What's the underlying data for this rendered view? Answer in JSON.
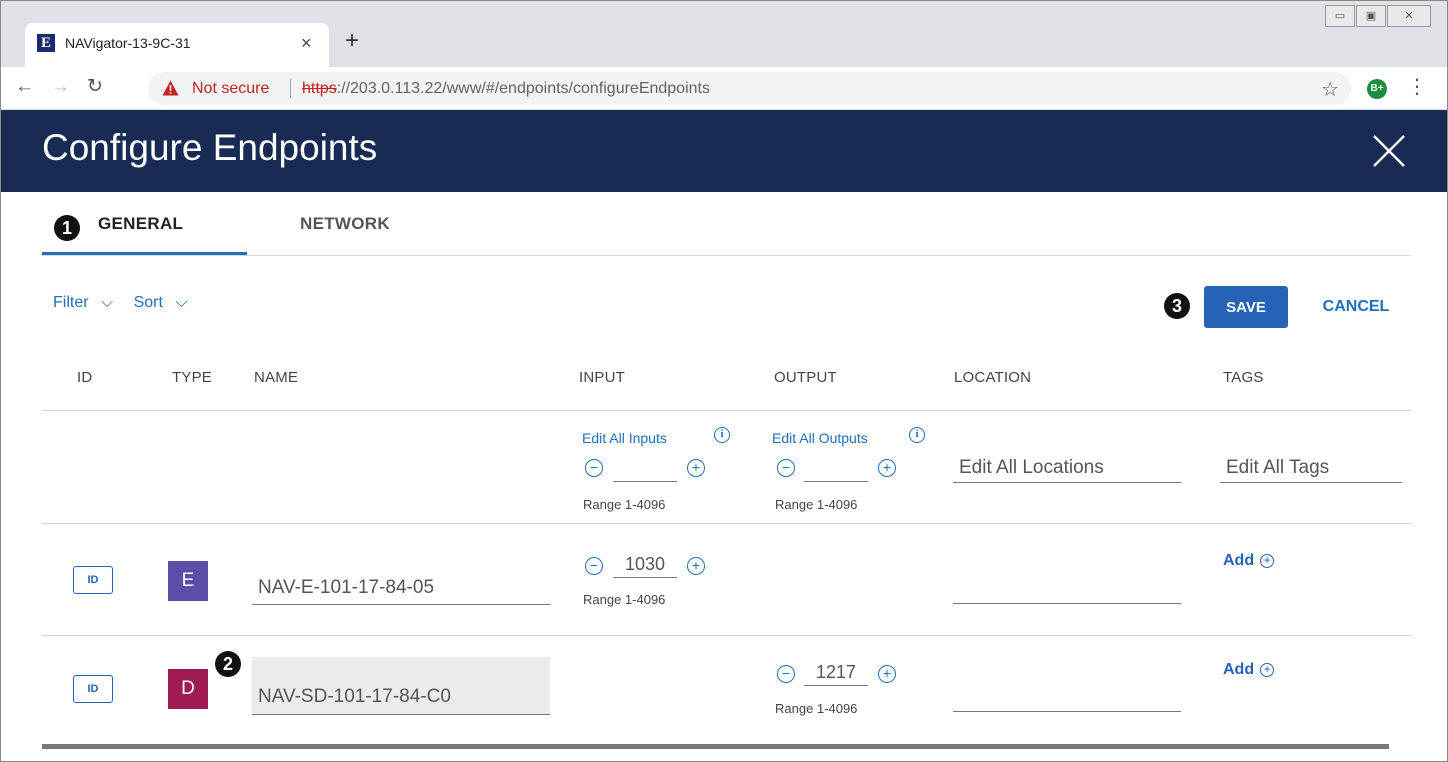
{
  "browser": {
    "tab_title": "NAVigator-13-9C-31",
    "favicon_letter": "E",
    "close_tab_glyph": "×",
    "new_tab_glyph": "+",
    "not_secure": "Not secure",
    "url_scheme": "https",
    "url_rest": "://203.0.113.22/www/#/endpoints/configureEndpoints",
    "profile_badge": "B+",
    "window_controls": [
      "▭",
      "▣",
      "✕"
    ]
  },
  "app": {
    "title": "Configure Endpoints",
    "tabs": [
      {
        "label": "GENERAL",
        "active": true
      },
      {
        "label": "NETWORK",
        "active": false
      }
    ],
    "callouts": [
      "1",
      "2",
      "3"
    ],
    "filter_label": "Filter",
    "sort_label": "Sort",
    "save_label": "SAVE",
    "cancel_label": "CANCEL",
    "columns": [
      "ID",
      "TYPE",
      "NAME",
      "INPUT",
      "OUTPUT",
      "LOCATION",
      "TAGS"
    ],
    "edit_all": {
      "inputs_label": "Edit All Inputs",
      "outputs_label": "Edit All Outputs",
      "range": "Range 1-4096",
      "locations_placeholder": "Edit All Locations",
      "tags_placeholder": "Edit All Tags"
    },
    "rows": [
      {
        "id_label": "ID",
        "type": "E",
        "type_color": "#5a4fa8",
        "name": "NAV-E-101-17-84-05",
        "input": "1030",
        "range": "Range 1-4096",
        "add_label": "Add"
      },
      {
        "id_label": "ID",
        "type": "D",
        "type_color": "#9e1c52",
        "name": "NAV-SD-101-17-84-C0",
        "output": "1217",
        "range": "Range 1-4096",
        "add_label": "Add"
      }
    ]
  },
  "colors": {
    "header_bg": "#182b54",
    "accent": "#2662b5",
    "link": "#1f6fbf",
    "not_secure": "#c5221f"
  }
}
